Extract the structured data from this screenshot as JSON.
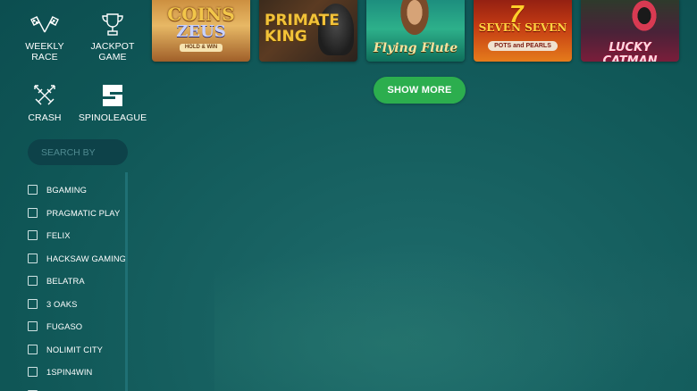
{
  "promos": [
    {
      "label": "WEEKLY\nRACE",
      "icon": "checkered-flags-icon"
    },
    {
      "label": "JACKPOT\nGAME",
      "icon": "trophy-icon"
    },
    {
      "label": "CRASH",
      "icon": "crossed-swords-icon"
    },
    {
      "label": "SPINOLEAGUE",
      "icon": "spinoleague-logo-icon"
    }
  ],
  "search": {
    "placeholder": "SEARCH BY"
  },
  "providers": [
    "BGAMING",
    "PRAGMATIC PLAY",
    "FELIX",
    "HACKSAW GAMING",
    "BELATRA",
    "3 OAKS",
    "FUGASO",
    "NOLIMIT CITY",
    "1SPIN4WIN"
  ],
  "games": [
    {
      "title": "COINS",
      "subtitle": "ZEUS",
      "tag": "HOLD & WIN"
    },
    {
      "title": "PRIMATE KING"
    },
    {
      "title": "Flying Flute"
    },
    {
      "title": "SEVEN SEVEN",
      "tag": "POTS and PEARLS",
      "badge": "7"
    },
    {
      "title": "LUCKY CATMAN"
    }
  ],
  "show_more_label": "SHOW MORE",
  "colors": {
    "accent_green": "#2cae4e",
    "background": "#176161",
    "search_bg": "#0d4249"
  }
}
